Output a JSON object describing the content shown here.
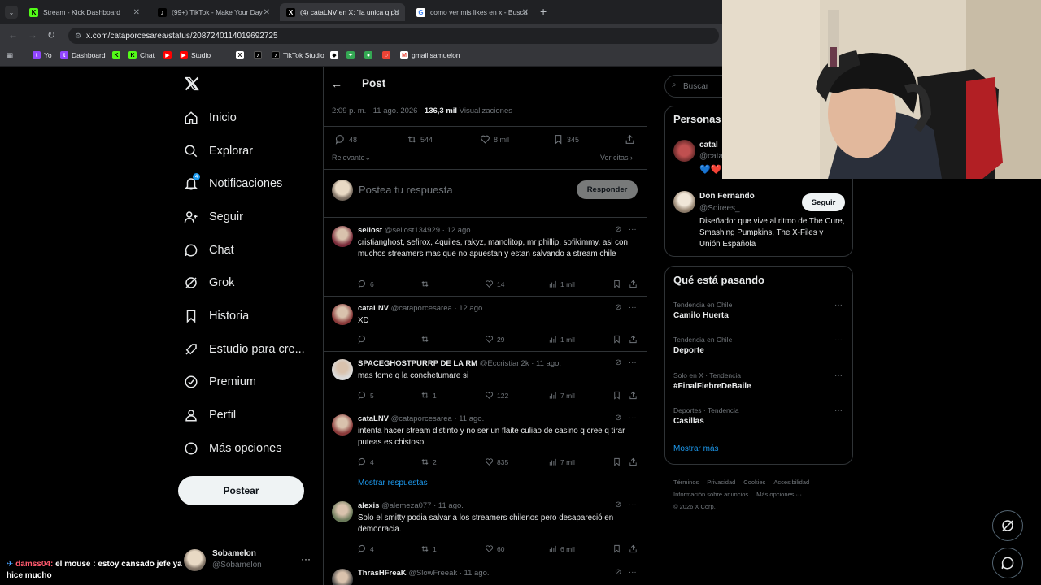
{
  "browser": {
    "tabs": [
      {
        "title": "Stream - Kick Dashboard",
        "fav": "K",
        "favcolor": "#53fc18"
      },
      {
        "title": "(99+) TikTok - Make Your Day",
        "fav": "♪",
        "favcolor": "#ffffff"
      },
      {
        "title": "(4) cataLNV en X: \"la unica q pu",
        "fav": "X",
        "favcolor": "#ffffff"
      },
      {
        "title": "como ver mis likes en x - Busca",
        "fav": "G",
        "favcolor": "#4285f4"
      }
    ],
    "url": "x.com/cataporcesarea/status/2087240114019692725",
    "bookmarks": [
      {
        "label": "Yo",
        "color": "#9146ff"
      },
      {
        "label": "Dashboard",
        "color": "#9146ff"
      },
      {
        "label": "",
        "color": "#53fc18"
      },
      {
        "label": "Chat",
        "color": "#53fc18"
      },
      {
        "label": "",
        "color": "#ff0000"
      },
      {
        "label": "Studio",
        "color": "#ff0000"
      },
      {
        "label": "",
        "color": "#ffffff"
      },
      {
        "label": "",
        "color": "#ffffff"
      },
      {
        "label": "TikTok Studio",
        "color": "#ffffff"
      },
      {
        "label": "",
        "color": "#ffffff"
      },
      {
        "label": "",
        "color": "#34a853"
      },
      {
        "label": "",
        "color": "#34a853"
      },
      {
        "label": "",
        "color": "#ea4335"
      },
      {
        "label": "gmail samuelon",
        "color": "#ea4335"
      }
    ]
  },
  "nav": {
    "items": [
      "Inicio",
      "Explorar",
      "Notificaciones",
      "Seguir",
      "Chat",
      "Grok",
      "Historia",
      "Estudio para cre...",
      "Premium",
      "Perfil",
      "Más opciones"
    ],
    "badge": "4",
    "post_button": "Postear",
    "me_name": "Sobamelon",
    "me_handle": "@Sobamelon"
  },
  "chat_overlay": {
    "user": "damss04:",
    "message": " el mouse : estoy cansado jefe ya hice mucho"
  },
  "post": {
    "back": "←",
    "title": "Post",
    "time": "2:09 p. m. · 11 ago. 2026 · ",
    "views_count": "136,3 mil",
    "views_label": " Visualizaciones",
    "stats": {
      "replies": "48",
      "reposts": "544",
      "likes": "8 mil",
      "bookmarks": "345"
    },
    "sort": "Relevante",
    "quotes": "Ver citas",
    "reply_placeholder": "Postea tu respuesta",
    "reply_button": "Responder"
  },
  "replies": [
    {
      "name": "seilost",
      "handle": "@seilost134929 · 12 ago.",
      "text": "cristianghost, sefirox, 4quiles, rakyz, manolitop, mr phillip, sofikimmy, asi con muchos streamers mas que no apuestan y estan salvando a stream chile",
      "replies": "6",
      "reposts": "",
      "likes": "14",
      "views": "1 mil",
      "color": "#7a2b3a"
    },
    {
      "name": "cataLNV",
      "handle": "@cataporcesarea · 12 ago.",
      "text": "XD",
      "replies": "",
      "reposts": "",
      "likes": "29",
      "views": "1 mil",
      "color": "#8a3a3a"
    },
    {
      "name": "SPACEGHOSTPURRP DE LA RM",
      "handle": "@Eccristian2k · 11 ago.",
      "text": "mas fome q la conchetumare si",
      "replies": "5",
      "reposts": "1",
      "likes": "122",
      "views": "7 mil",
      "color": "#dcdcdc"
    },
    {
      "name": "cataLNV",
      "handle": "@cataporcesarea · 11 ago.",
      "text": "intenta hacer stream distinto y no ser un flaite culiao de casino q cree q tirar puteas es chistoso",
      "replies": "4",
      "reposts": "2",
      "likes": "835",
      "views": "7 mil",
      "color": "#8a3a3a"
    },
    {
      "name": "alexis",
      "handle": "@alemeza077 · 11 ago.",
      "text": "Solo el smitty podia salvar a los streamers chilenos pero desapareció en democracia.",
      "replies": "4",
      "reposts": "1",
      "likes": "60",
      "views": "6 mil",
      "color": "#6a7a5a"
    },
    {
      "name": "ThrasHFreaK",
      "handle": "@SlowFreeak · 11 ago.",
      "text": "",
      "replies": "",
      "reposts": "",
      "likes": "",
      "views": "",
      "color": "#444444"
    }
  ],
  "show_replies": "Mostrar respuestas",
  "right": {
    "search_placeholder": "Buscar",
    "who_title": "Personas",
    "who1_name": "catal",
    "who1_handle": "@cata",
    "who1_hearts": "💙❤️",
    "who2_name": "Don Fernando",
    "who2_handle": "@Soirees_",
    "who2_bio": "Diseñador que vive al ritmo de The Cure, Smashing Pumpkins, The X-Files y Unión Española",
    "follow": "Seguir",
    "trends_title": "Qué está pasando",
    "trends": [
      {
        "context": "Tendencia en Chile",
        "name": "Camilo Huerta"
      },
      {
        "context": "Tendencia en Chile",
        "name": "Deporte"
      },
      {
        "context": "Solo en X · Tendencia",
        "name": "#FinalFiebreDeBaile"
      },
      {
        "context": "Deportes · Tendencia",
        "name": "Casillas"
      }
    ],
    "show_more": "Mostrar más",
    "footer": [
      "Términos",
      "Privacidad",
      "Cookies",
      "Accesibilidad",
      "Información sobre anuncios",
      "Más opciones ···",
      "© 2026 X Corp."
    ]
  }
}
